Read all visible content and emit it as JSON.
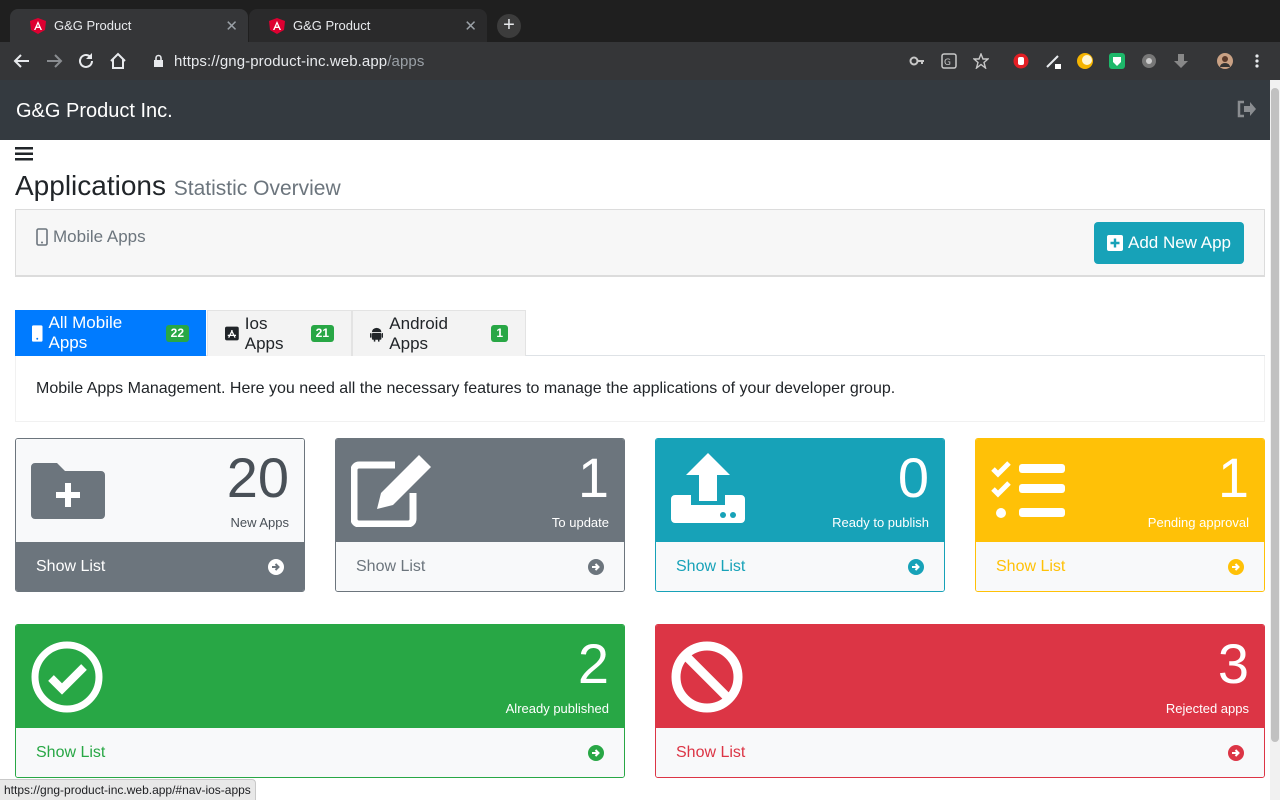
{
  "browser": {
    "tabs": [
      {
        "title": "G&G Product"
      },
      {
        "title": "G&G Product"
      }
    ],
    "url_host": "https://gng-product-inc.web.app",
    "url_path": "/apps",
    "status_url": "https://gng-product-inc.web.app/#nav-ios-apps"
  },
  "header": {
    "brand": "G&G Product Inc."
  },
  "page": {
    "title": "Applications",
    "subtitle": "Statistic Overview"
  },
  "panel": {
    "title": "Mobile Apps",
    "add_button": "Add New App"
  },
  "tabs": [
    {
      "label": "All Mobile Apps",
      "count": "22",
      "icon": "mobile-icon"
    },
    {
      "label": "Ios Apps",
      "count": "21",
      "icon": "app-store-icon"
    },
    {
      "label": "Android Apps",
      "count": "1",
      "icon": "android-icon"
    }
  ],
  "description": "Mobile Apps Management. Here you need all the necessary features to manage the applications of your developer group.",
  "stats": [
    {
      "count": "20",
      "label": "New Apps",
      "link": "Show List",
      "icon": "folder-plus-icon",
      "color": "#6c757d"
    },
    {
      "count": "1",
      "label": "To update",
      "link": "Show List",
      "icon": "edit-icon",
      "color": "#6c757d"
    },
    {
      "count": "0",
      "label": "Ready to publish",
      "link": "Show List",
      "icon": "upload-icon",
      "color": "#17a2b8"
    },
    {
      "count": "1",
      "label": "Pending approval",
      "link": "Show List",
      "icon": "checklist-icon",
      "color": "#ffc107"
    },
    {
      "count": "2",
      "label": "Already published",
      "link": "Show List",
      "icon": "check-circle-icon",
      "color": "#28a745"
    },
    {
      "count": "3",
      "label": "Rejected apps",
      "link": "Show List",
      "icon": "ban-icon",
      "color": "#dc3545"
    }
  ]
}
